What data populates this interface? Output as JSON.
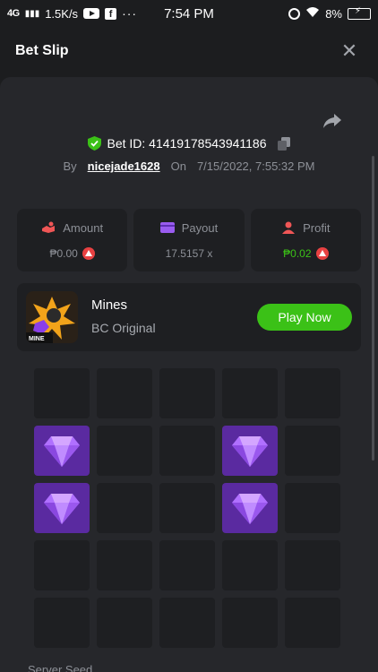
{
  "status_bar": {
    "network": "4G",
    "speed": "1.5K/s",
    "more": "···",
    "time": "7:54 PM",
    "battery": "8%"
  },
  "header": {
    "title": "Bet Slip",
    "close": "✕"
  },
  "bet": {
    "id_label": "Bet ID: 41419178543941186",
    "by_label": "By",
    "user": "nicejade1628",
    "on_label": "On",
    "datetime": "7/15/2022, 7:55:32 PM"
  },
  "stats": [
    {
      "label": "Amount",
      "value": "₱0.00",
      "icon": "money-hand-icon",
      "color": "#f05656",
      "coin": true
    },
    {
      "label": "Payout",
      "value": "17.5157 x",
      "icon": "payout-card-icon",
      "color": "#9a5cf0",
      "coin": false
    },
    {
      "label": "Profit",
      "value": "₱0.02",
      "icon": "profit-user-icon",
      "color": "#f05656",
      "coin": true
    }
  ],
  "game": {
    "name": "Mines",
    "subtitle": "BC Original",
    "play_label": "Play Now",
    "thumb_label": "MINE"
  },
  "grid": {
    "rows": 5,
    "cols": 5,
    "gems": [
      [
        1,
        0
      ],
      [
        1,
        3
      ],
      [
        2,
        0
      ],
      [
        2,
        3
      ]
    ],
    "gem_color": "#5a2aa0"
  },
  "footer": {
    "server_seed_label": "Server Seed"
  },
  "colors": {
    "accent": "#3bc117",
    "background": "#1c1d1f",
    "panel": "#26272b"
  }
}
